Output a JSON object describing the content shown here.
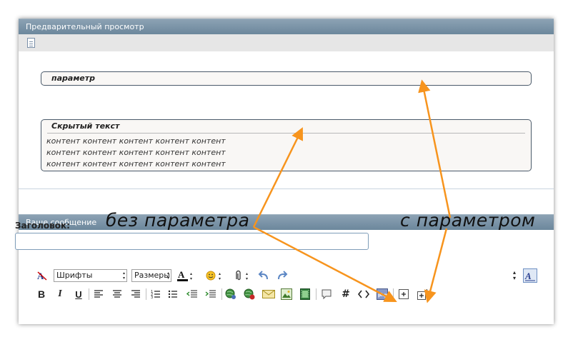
{
  "preview": {
    "title": "Предварительный просмотр",
    "spoiler_param_label": "параметр",
    "spoiler_hidden_label": "Скрытый текст",
    "content_lines": [
      "контент контент контент контент контент",
      "контент контент контент контент контент",
      "контент контент контент контент контент"
    ]
  },
  "message": {
    "title": "Ваше сообщение",
    "subject_label": "Заголовок:",
    "subject_value": ""
  },
  "toolbar": {
    "fonts_label": "Шрифты",
    "sizes_label": "Размеры"
  },
  "annotations": {
    "without_param": "без параметра",
    "with_param": "с параметром",
    "arrow_color": "#f7941d"
  },
  "colors": {
    "titlebar": "#7a93a8",
    "spoiler_border": "#4a5a6a",
    "input_border": "#7f9db9"
  }
}
